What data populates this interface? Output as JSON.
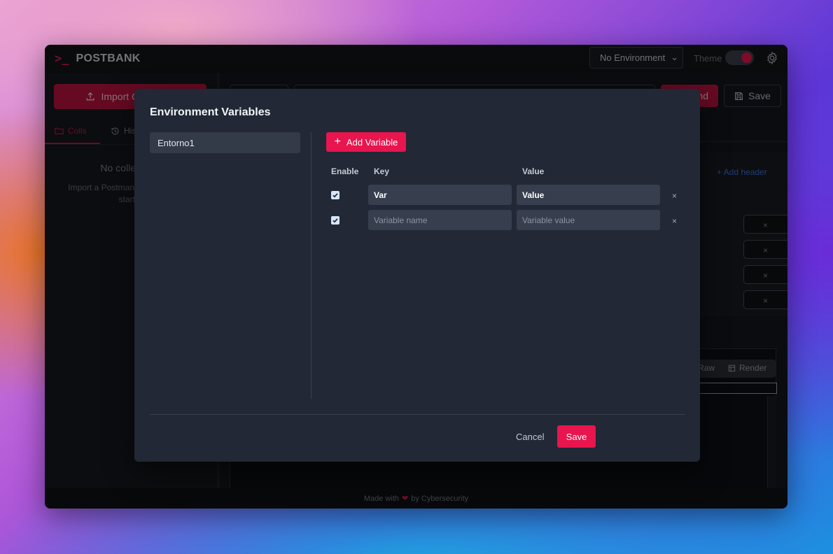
{
  "app": {
    "logo_mark": ">_",
    "title": "POSTBANK",
    "environment_select": "No Environment",
    "theme_label": "Theme",
    "accent_color": "#e8154e"
  },
  "sidebar": {
    "import_label": "Import Collection",
    "tabs": [
      {
        "label": "Colls",
        "icon": "folder-icon"
      },
      {
        "label": "History",
        "icon": "history-icon"
      }
    ],
    "empty_title": "No collections",
    "empty_description": "Import a Postman collection to get started"
  },
  "request": {
    "send_label": "Send",
    "save_label": "Save",
    "add_header_label": "+ Add header",
    "response_tabs": [
      "Raw",
      "Render"
    ]
  },
  "footer": {
    "prefix": "Made with",
    "suffix": "by Cybersecurity"
  },
  "modal": {
    "title": "Environment Variables",
    "environments": [
      "Entorno1"
    ],
    "add_variable_label": "Add Variable",
    "columns": {
      "enable": "Enable",
      "key": "Key",
      "value": "Value"
    },
    "variables": [
      {
        "enabled": true,
        "key": "Var",
        "value": "Value"
      },
      {
        "enabled": true,
        "key_placeholder": "Variable name",
        "value_placeholder": "Variable value"
      }
    ],
    "cancel_label": "Cancel",
    "save_label": "Save"
  }
}
